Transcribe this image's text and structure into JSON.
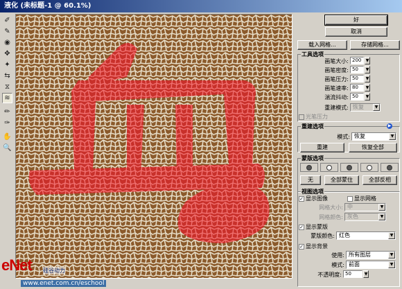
{
  "window": {
    "title": "液化 (未标题-1 @ 60.1%)"
  },
  "tools": [
    {
      "name": "forward-warp-tool-icon",
      "glyph": "✐"
    },
    {
      "name": "reconstruct-tool-icon",
      "glyph": "✎"
    },
    {
      "name": "twirl-tool-icon",
      "glyph": "◉"
    },
    {
      "name": "pucker-tool-icon",
      "glyph": "✥"
    },
    {
      "name": "bloat-tool-icon",
      "glyph": "✦"
    },
    {
      "name": "push-left-tool-icon",
      "glyph": "⇆"
    },
    {
      "name": "mirror-tool-icon",
      "glyph": "⧖"
    },
    {
      "name": "turbulence-tool-icon",
      "glyph": "≋"
    },
    {
      "name": "freeze-mask-tool-icon",
      "glyph": "✏"
    },
    {
      "name": "thaw-mask-tool-icon",
      "glyph": "✑"
    },
    {
      "name": "hand-tool-icon",
      "glyph": "✋"
    },
    {
      "name": "zoom-tool-icon",
      "glyph": "🔍"
    }
  ],
  "selected_tool_index": 7,
  "buttons": {
    "ok": "好",
    "cancel": "取消",
    "load_mesh": "载入网格...",
    "save_mesh": "存储网格..."
  },
  "tool_options": {
    "title": "工具选项",
    "fields": [
      {
        "label": "画笔大小:",
        "value": "200"
      },
      {
        "label": "画笔密度:",
        "value": "50"
      },
      {
        "label": "画笔压力:",
        "value": "50"
      },
      {
        "label": "画笔速率:",
        "value": "80"
      },
      {
        "label": "湍流抖动:",
        "value": "50"
      }
    ],
    "reconstruct_mode_label": "重建模式:",
    "reconstruct_mode_value": "恢复",
    "stylus_pressure": "光笔压力"
  },
  "reconstruct_options": {
    "title": "重建选项",
    "mode_label": "模式:",
    "mode_value": "恢复",
    "reconstruct_button": "重建",
    "restore_all_button": "恢复全部"
  },
  "mask_options": {
    "title": "蒙版选项",
    "none_button": "无",
    "mask_all_button": "全部蒙住",
    "invert_all_button": "全部反相"
  },
  "view_options": {
    "title": "视图选项",
    "show_image": "显示图像",
    "show_mesh": "显示网格",
    "mesh_size_label": "网格大小:",
    "mesh_size_value": "中",
    "mesh_color_label": "网格颜色:",
    "mesh_color_value": "灰色",
    "show_mask": "显示蒙版",
    "mask_color_label": "蒙版颜色:",
    "mask_color_value": "红色",
    "show_backdrop": "显示背景",
    "use_label": "使用:",
    "use_value": "所有图层",
    "mode_label": "模式:",
    "mode_value": "前面",
    "opacity_label": "不透明度:",
    "opacity_value": "50"
  },
  "watermark": {
    "logo": "eNet",
    "tagline": "硅谷动力",
    "url": "www.enet.com.cn/eschool"
  },
  "colors": {
    "canvas_brown": "#8b5a2b",
    "mask_red": "#c8302a",
    "crack_white": "#e6dcc6"
  }
}
